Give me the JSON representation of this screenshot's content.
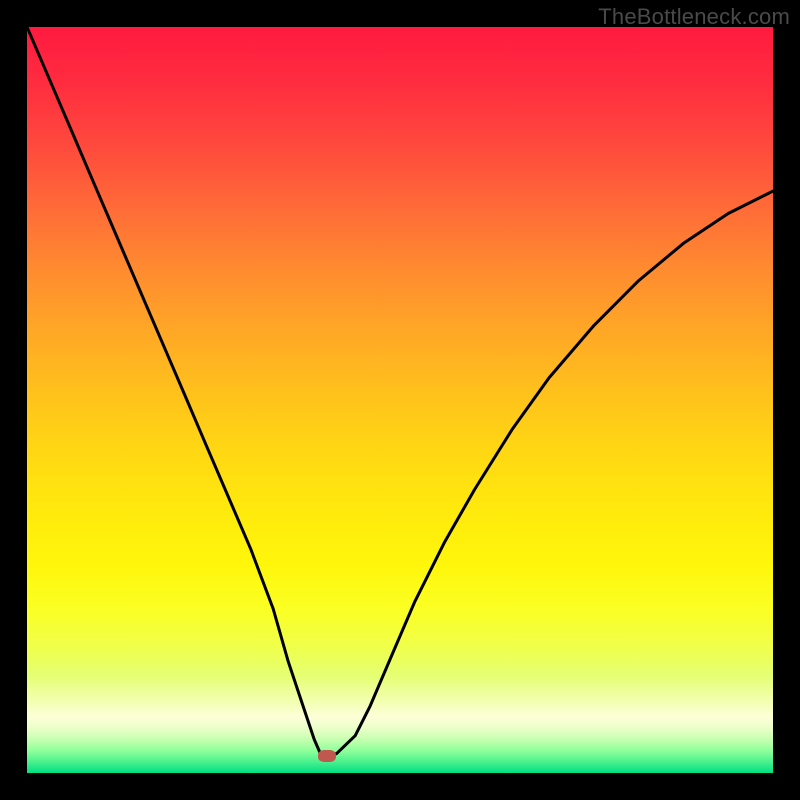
{
  "watermark": "TheBottleneck.com",
  "marker": {
    "x_frac": 0.402,
    "y_frac": 0.977
  },
  "chart_data": {
    "type": "line",
    "title": "",
    "xlabel": "",
    "ylabel": "",
    "xlim": [
      0,
      100
    ],
    "ylim": [
      0,
      100
    ],
    "series": [
      {
        "name": "curve",
        "x": [
          0,
          3,
          6,
          9,
          12,
          15,
          18,
          21,
          24,
          27,
          30,
          33,
          35,
          37,
          38.5,
          39.5,
          40.2,
          41.5,
          44,
          46,
          49,
          52,
          56,
          60,
          65,
          70,
          76,
          82,
          88,
          94,
          100
        ],
        "y": [
          100,
          93,
          86,
          79,
          72,
          65,
          58,
          51,
          44,
          37,
          30,
          22,
          15,
          9,
          4.5,
          2.2,
          2.3,
          2.6,
          5,
          9,
          16,
          23,
          31,
          38,
          46,
          53,
          60,
          66,
          71,
          75,
          78
        ]
      }
    ],
    "annotations": [
      {
        "type": "marker",
        "x": 40.2,
        "y": 2.3,
        "shape": "rounded-rect",
        "color": "#c1584f"
      }
    ],
    "background": {
      "type": "vertical-gradient",
      "stops": [
        {
          "pos": 0.0,
          "color": "#ff1a3f"
        },
        {
          "pos": 0.5,
          "color": "#ffd000"
        },
        {
          "pos": 0.8,
          "color": "#f6ff40"
        },
        {
          "pos": 0.93,
          "color": "#fcffd8"
        },
        {
          "pos": 1.0,
          "color": "#00e082"
        }
      ]
    }
  }
}
